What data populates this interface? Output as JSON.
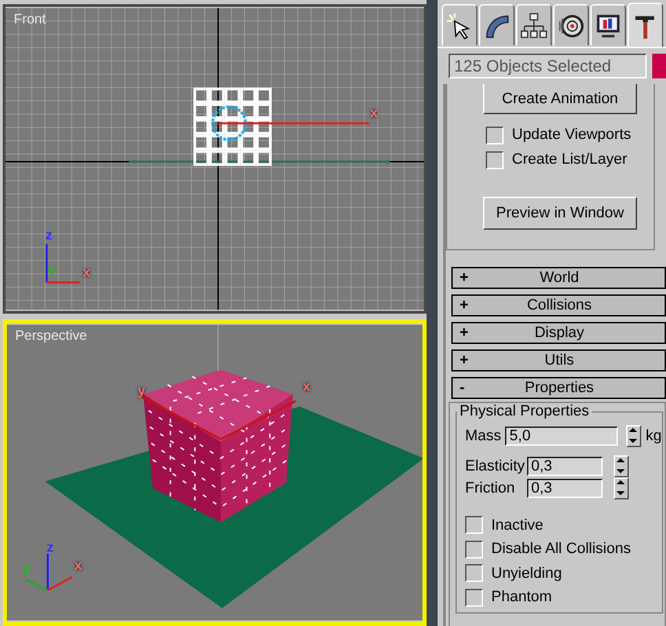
{
  "viewports": [
    {
      "title": "Front",
      "kind": "front",
      "active": false,
      "gizmo_labels": [
        "x"
      ],
      "tripod_labels": [
        "z",
        "y",
        "x"
      ]
    },
    {
      "title": "Perspective",
      "kind": "perspective",
      "active": true,
      "gizmo_labels": [
        "y",
        "x"
      ],
      "tripod_labels": [
        "z",
        "y",
        "x"
      ]
    }
  ],
  "command_tabs": [
    {
      "kind": "create",
      "selected": false
    },
    {
      "kind": "modify",
      "selected": false
    },
    {
      "kind": "hierarchy",
      "selected": false
    },
    {
      "kind": "motion",
      "selected": false
    },
    {
      "kind": "display",
      "selected": false
    },
    {
      "kind": "utilities",
      "selected": true
    }
  ],
  "name_field": {
    "value": "125 Objects Selected"
  },
  "top_rollout": [
    {
      "kind": "button",
      "label": "Create Animation"
    },
    {
      "kind": "checkbox",
      "label": "Update Viewports",
      "checked": false
    },
    {
      "kind": "checkbox",
      "label": "Create List/Layer",
      "checked": false
    },
    {
      "kind": "button",
      "label": "Preview in Window"
    }
  ],
  "rollouts": [
    {
      "kind": "collapsed",
      "sign": "+",
      "title": "World"
    },
    {
      "kind": "collapsed",
      "sign": "+",
      "title": "Collisions"
    },
    {
      "kind": "collapsed",
      "sign": "+",
      "title": "Display"
    },
    {
      "kind": "collapsed",
      "sign": "+",
      "title": "Utils"
    },
    {
      "kind": "properties",
      "sign": "-",
      "title": "Properties"
    }
  ],
  "properties": {
    "group_title": "Physical Properties",
    "fields": [
      {
        "label": "Mass",
        "value": "5,0",
        "unit": "kg"
      },
      {
        "label": "Elasticity",
        "value": "0,3"
      },
      {
        "label": "Friction",
        "value": "0,3"
      }
    ],
    "checkboxes": [
      {
        "label": "Inactive",
        "checked": false
      },
      {
        "label": "Disable All Collisions",
        "checked": false
      },
      {
        "label": "Unyielding",
        "checked": false
      },
      {
        "label": "Phantom",
        "checked": false
      }
    ]
  }
}
